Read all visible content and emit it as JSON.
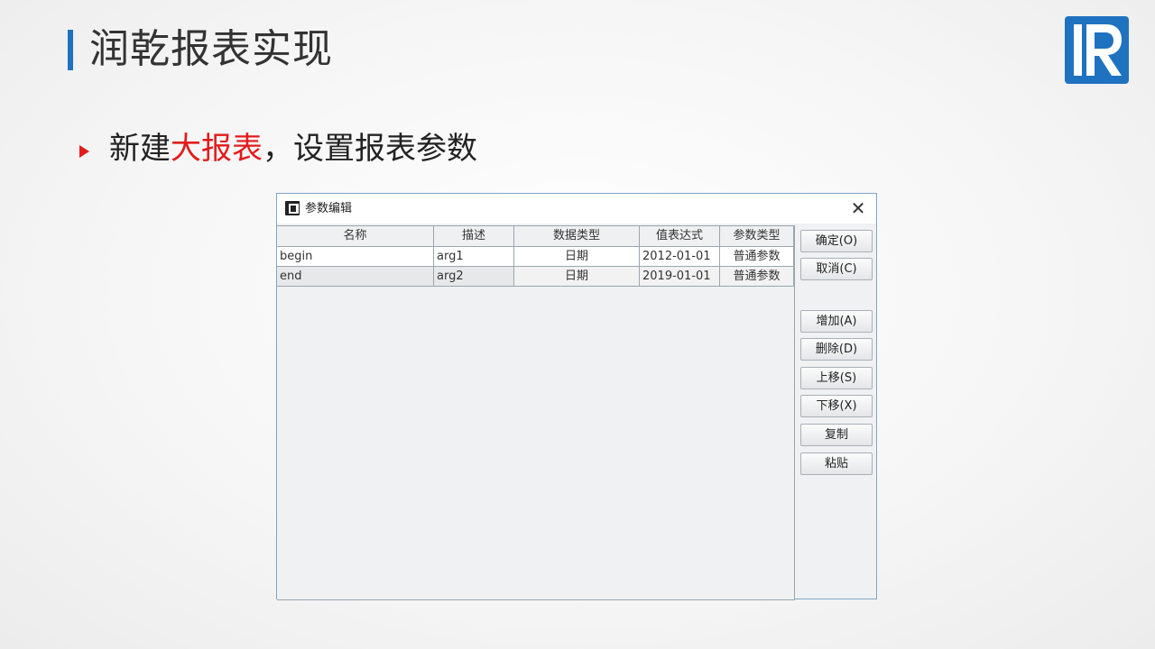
{
  "slide": {
    "title": "润乾报表实现",
    "bullet_prefix": "新建",
    "bullet_highlight": "大报表",
    "bullet_suffix": "，设置报表参数",
    "accent_color": "#1f72bf",
    "highlight_color": "#e21c1c"
  },
  "logo": {
    "icon": "raqsoft-r-logo-icon"
  },
  "dialog": {
    "title": "参数编辑",
    "close_glyph": "✕",
    "columns": [
      "名称",
      "描述",
      "数据类型",
      "值表达式",
      "参数类型"
    ],
    "rows": [
      [
        "begin",
        "arg1",
        "日期",
        "2012-01-01",
        "普通参数"
      ],
      [
        "end",
        "arg2",
        "日期",
        "2019-01-01",
        "普通参数"
      ]
    ],
    "buttons": {
      "ok": "确定(O)",
      "cancel": "取消(C)",
      "add": "增加(A)",
      "delete": "删除(D)",
      "move_up": "上移(S)",
      "move_down": "下移(X)",
      "copy": "复制",
      "paste": "粘贴"
    }
  }
}
